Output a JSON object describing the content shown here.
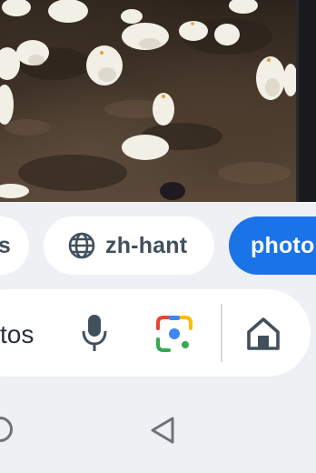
{
  "image": {
    "description": "chicks on soil",
    "icon": "photo-thumbnail"
  },
  "chips": [
    {
      "label": "s",
      "icon": null,
      "selected": false
    },
    {
      "label": "zh-hant",
      "icon": "globe-icon",
      "selected": false
    },
    {
      "label": "photo",
      "icon": null,
      "selected": true
    }
  ],
  "search": {
    "query_visible": "tos",
    "icons": [
      "mic-icon",
      "google-lens-icon",
      "home-icon"
    ]
  },
  "navbar": {
    "icons": [
      "home-circle-icon",
      "back-triangle-icon"
    ]
  },
  "colors": {
    "accent": "#1b73e8",
    "chip_text": "#41505c",
    "background": "#eef0f4"
  }
}
